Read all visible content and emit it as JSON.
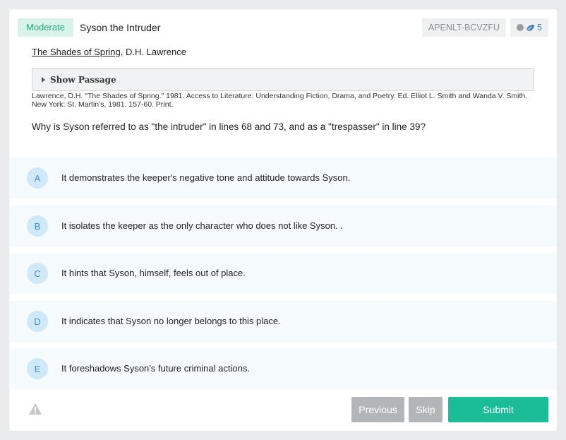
{
  "header": {
    "difficulty": "Moderate",
    "title": "Syson the Intruder",
    "code": "APENLT-BCVZFU",
    "count": "5"
  },
  "source": {
    "work": "The Shades of Spring,",
    "author": " D.H. Lawrence"
  },
  "passage": {
    "toggle_label": "Show Passage",
    "citation": "Lawrence, D.H. \"The Shades of Spring.\" 1981. Access to Literature: Understanding Fiction, Drama, and Poetry. Ed. Elliot L. Smith and Wanda V. Smith. New York: St. Martin's, 1981. 157-60. Print."
  },
  "question": "Why is Syson referred to as \"the intruder\" in lines 68 and 73, and as a \"trespasser\" in line 39?",
  "choices": [
    {
      "letter": "A",
      "text": "It demonstrates the keeper's negative tone and attitude towards Syson."
    },
    {
      "letter": "B",
      "text": "It isolates the keeper as the only character who does not like Syson. ."
    },
    {
      "letter": "C",
      "text": "It hints that Syson, himself, feels out of place."
    },
    {
      "letter": "D",
      "text": "It indicates that Syson no longer belongs to this place."
    },
    {
      "letter": "E",
      "text": "It foreshadows Syson's future criminal actions."
    }
  ],
  "footer": {
    "previous_label": "Previous",
    "skip_label": "Skip",
    "submit_label": "Submit"
  },
  "icons": {
    "status": "dot-icon",
    "count": "leaf-icon",
    "toggle": "triangle-right-icon",
    "report": "warning-icon"
  },
  "colors": {
    "accent": "#1bbc98",
    "difficulty_bg": "#d7f3ea",
    "difficulty_text": "#2aa57c",
    "choice_bg": "#f5fafd",
    "choice_badge": "#cfe9f8"
  }
}
